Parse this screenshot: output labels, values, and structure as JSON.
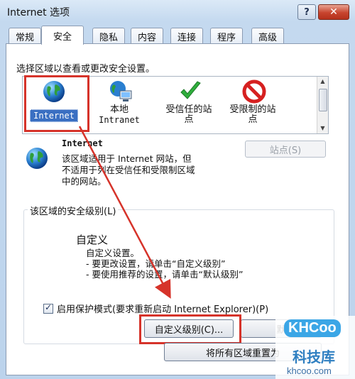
{
  "window": {
    "title": "Internet 选项",
    "help_label": "?",
    "close_label": "✕"
  },
  "tabs": [
    {
      "label": "常规"
    },
    {
      "label": "安全"
    },
    {
      "label": "隐私"
    },
    {
      "label": "内容"
    },
    {
      "label": "连接"
    },
    {
      "label": "程序"
    },
    {
      "label": "高级"
    }
  ],
  "active_tab": "安全",
  "security": {
    "instruction": "选择区域以查看或更改安全设置。",
    "zones": [
      {
        "line1": "Internet",
        "line2": "",
        "icon": "globe-icon"
      },
      {
        "line1": "本地",
        "line2": "Intranet",
        "icon": "local-intranet-icon"
      },
      {
        "line1": "受信任的站",
        "line2": "点",
        "icon": "checkmark-icon"
      },
      {
        "line1": "受限制的站",
        "line2": "点",
        "icon": "restricted-icon"
      }
    ],
    "selected_zone": {
      "title": "Internet",
      "description_lines": [
        "该区域适用于 Internet 网站，但",
        "不适用于列在受信任和受限制区域",
        "中的网站。"
      ],
      "sites_button": "站点(S)"
    },
    "level_group_label": "该区域的安全级别(L)",
    "level": {
      "name": "自定义",
      "lines": [
        "自定义设置。",
        "- 要更改设置，请单击“自定义级别”",
        "- 要使用推荐的设置，请单击“默认级别”"
      ]
    },
    "protected_mode": {
      "label": "启用保护模式(要求重新启动 Internet Explorer)(P)",
      "checked": true
    },
    "custom_level_button": "自定义级别(C)...",
    "default_level_button": "默",
    "reset_all_button": "将所有区域重置为"
  },
  "colors": {
    "highlight": "#d6332a",
    "selection": "#3a6fc2"
  },
  "watermark": {
    "logo": "KHCoo",
    "cn": "科技库",
    "url": "khcoo.com"
  }
}
